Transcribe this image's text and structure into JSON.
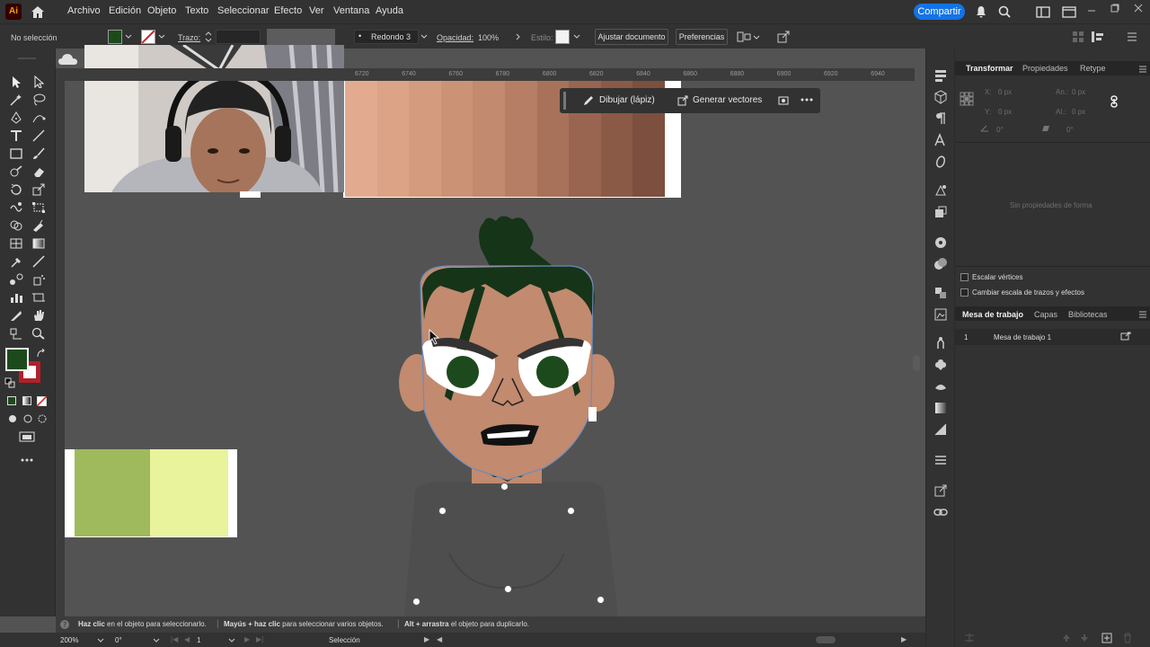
{
  "menubar": {
    "app_logo": "Ai",
    "items": [
      "Archivo",
      "Edición",
      "Objeto",
      "Texto",
      "Seleccionar",
      "Efecto",
      "Ver",
      "Ventana",
      "Ayuda"
    ],
    "share_label": "Compartir"
  },
  "controlbar": {
    "selection_status": "No selección",
    "stroke_label": "Trazo:",
    "brush_value": "Redondo 3 ...",
    "opacity_label": "Opacidad:",
    "opacity_value": "100%",
    "style_label": "Estilo:",
    "adjust_doc_label": "Ajustar documento",
    "preferences_label": "Preferencias"
  },
  "ruler": {
    "ticks": [
      "6720",
      "6740",
      "6760",
      "6780",
      "6800",
      "6820",
      "6840",
      "6860",
      "6880",
      "6900",
      "6920",
      "6940"
    ]
  },
  "float_bar": {
    "draw_label": "Dibujar (lápiz)",
    "vectorize_label": "Generar vectores"
  },
  "statusbar": {
    "hint_1_bold": "Haz clic",
    "hint_1": "en el objeto para seleccionarlo.",
    "hint_2_bold": "Mayús + haz clic",
    "hint_2": "para seleccionar varios objetos.",
    "hint_3_bold": "Alt + arrastra",
    "hint_3": "el objeto para duplicarlo."
  },
  "bottombar": {
    "zoom_value": "200%",
    "rotation_value": "0°",
    "artboard_number": "1",
    "mode": "Selección"
  },
  "rightpanel": {
    "tabs": [
      "Transformar",
      "Propiedades",
      "Retype"
    ],
    "x_label": "X:",
    "x_value": "0 px",
    "y_label": "Y:",
    "y_value": "0 px",
    "w_label": "An.:",
    "w_value": "0 px",
    "h_label": "Al.:",
    "h_value": "0 px",
    "angle_value": "0°",
    "shear_value": "0°",
    "empty_message": "Sin propiedades de forma",
    "scale_vertices": "Escalar vértices",
    "scale_strokes": "Cambiar escala de trazos y efectos",
    "lower_tabs": [
      "Mesa de trabajo",
      "Capas",
      "Bibliotecas"
    ],
    "artboard_row_number": "1",
    "artboard_row_name": "Mesa de trabajo 1"
  },
  "colors": {
    "accent_blue": "#1473e6",
    "fill_color": "#1d4a1c",
    "stroke_color": "#b3202a",
    "skin": "#c28a6e",
    "hair": "#163418",
    "shirt": "#4e4e4e",
    "swatch_green": "#9fba5c",
    "swatch_yellow": "#e9f39b"
  },
  "skin_swatches": [
    "#e2ab90",
    "#dca386",
    "#d49b7e",
    "#cb9276",
    "#c28a6e",
    "#b67f65",
    "#a8725a",
    "#996550",
    "#8a5a47",
    "#7c4f3e"
  ]
}
